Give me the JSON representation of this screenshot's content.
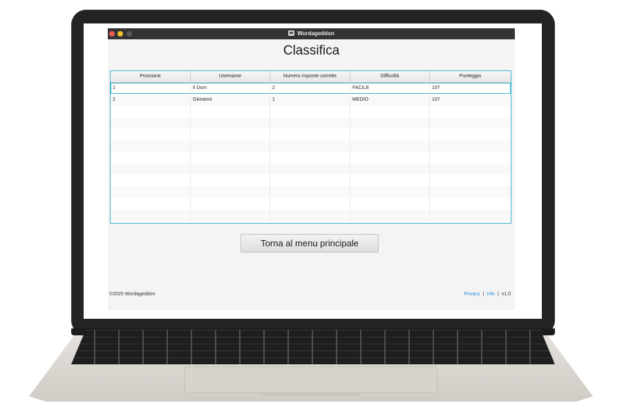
{
  "window": {
    "title": "Wordageddon"
  },
  "page": {
    "title": "Classifica"
  },
  "table": {
    "columns": [
      "Posizione",
      "Username",
      "Numero risposte corrette",
      "Difficoltà",
      "Punteggio"
    ],
    "rows": [
      [
        "1",
        "Il Dom",
        "2",
        "FACILE",
        "107"
      ],
      [
        "2",
        "Giovanni",
        "1",
        "MEDIO",
        "107"
      ]
    ],
    "selected_row": 0
  },
  "actions": {
    "back_label": "Torna al menu principale"
  },
  "footer": {
    "copyright": "©2025 Wordageddon",
    "privacy": "Privacy",
    "info": "Info",
    "version": "v1.0"
  },
  "colors": {
    "accent": "#38b3cf",
    "link": "#1f8fd6",
    "titlebar": "#333335"
  }
}
